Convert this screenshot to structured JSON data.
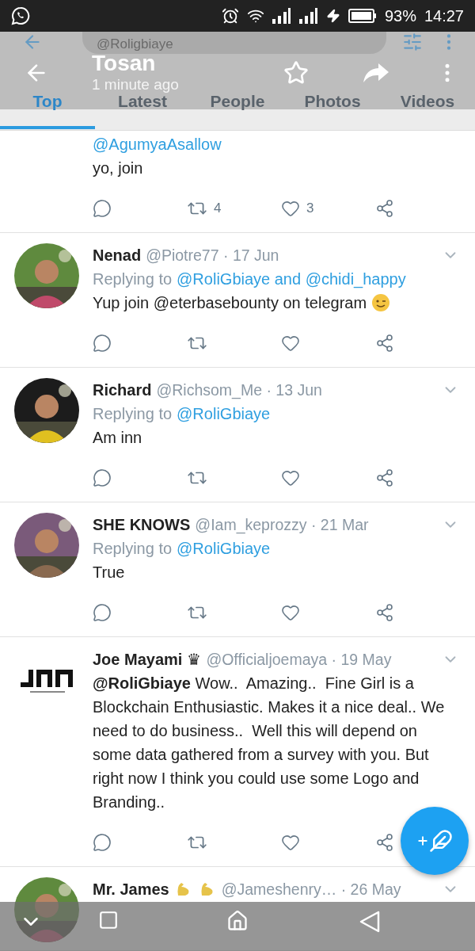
{
  "status_bar": {
    "battery": "93%",
    "time": "14:27"
  },
  "search": {
    "value": "@Roligbiaye"
  },
  "header": {
    "title": "Tosan",
    "subtitle": "1 minute ago"
  },
  "tabs": [
    {
      "label": "Top",
      "selected": true
    },
    {
      "label": "Latest",
      "selected": false
    },
    {
      "label": "People",
      "selected": false
    },
    {
      "label": "Photos",
      "selected": false
    },
    {
      "label": "Videos",
      "selected": false
    }
  ],
  "tweets": [
    {
      "kind": "partial",
      "mention_line": "@AgumyaAsallow",
      "text": "yo, join",
      "stats": {
        "retweets": "4",
        "likes": "3"
      }
    },
    {
      "kind": "full",
      "name": "Nenad",
      "meta": "@Piotre77 · 17 Jun",
      "replying_label": "Replying to",
      "replying_to": "@RoliGbiaye and @chidi_happy",
      "text": "Yup join @eterbasebounty on telegram",
      "text_emoji": {
        "kind": "wink"
      }
    },
    {
      "kind": "full",
      "name": "Richard",
      "meta": "@Richsom_Me · 13 Jun",
      "replying_label": "Replying to",
      "replying_to": "@RoliGbiaye",
      "text": "Am inn"
    },
    {
      "kind": "full",
      "name": "SHE KNOWS",
      "meta": "@Iam_keprozzy · 21 Mar",
      "replying_label": "Replying to",
      "replying_to": "@RoliGbiaye",
      "text": "True"
    },
    {
      "kind": "full",
      "avatar": {
        "kind": "logo"
      },
      "name": "Joe Mayami",
      "name_mark": "♛",
      "meta": "@Officialjoemaya · 19 May",
      "text": "**@RoliGbiaye** Wow..  Amazing..  Fine Girl is a Blockchain Enthusiastic. Makes it a nice deal.. We need to do business..  Well this will depend on some data gathered from a survey with you. But right now I think you could use some Logo and Branding.."
    },
    {
      "kind": "cut",
      "name": "Mr. James",
      "name_emojis": [
        {
          "kind": "muscle"
        },
        {
          "kind": "muscle"
        }
      ],
      "meta": "@Jameshenry… · 26 May"
    }
  ]
}
